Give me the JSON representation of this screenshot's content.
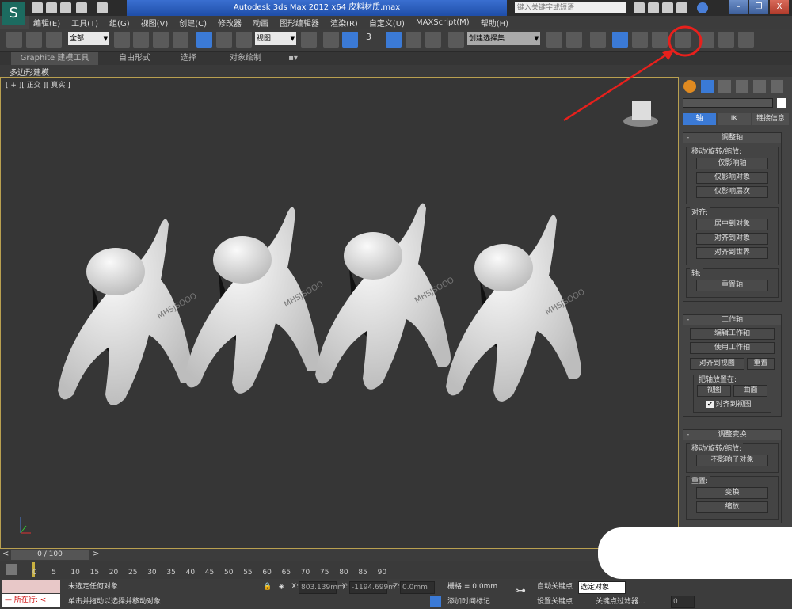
{
  "titlebar": {
    "title": "Autodesk 3ds Max  2012 x64     皮料材质.max",
    "search_placeholder": "键入关键字或短语",
    "min": "–",
    "restore": "❐",
    "close": "X"
  },
  "menu": [
    "编辑(E)",
    "工具(T)",
    "组(G)",
    "视图(V)",
    "创建(C)",
    "修改器",
    "动画",
    "图形编辑器",
    "渲染(R)",
    "自定义(U)",
    "MAXScript(M)",
    "帮助(H)"
  ],
  "toolbar": {
    "selection_filter": "全部",
    "ref_coord": "视图",
    "named_selection": "创建选择集",
    "angle_snap": "3"
  },
  "ribbon": {
    "tabs": [
      "Graphite 建模工具",
      "自由形式",
      "选择",
      "对象绘制"
    ],
    "sub": "多边形建模"
  },
  "viewport": {
    "label": "[ + ][ 正交 ][ 真实 ]",
    "text_on_model": "MHSJSOOO"
  },
  "panel": {
    "tabs": [
      "轴",
      "IK",
      "链接信息"
    ],
    "active_tab": "轴",
    "adjust_pivot": {
      "title": "调整轴",
      "move_group": "移动/旋转/缩放:",
      "buttons": [
        "仅影响轴",
        "仅影响对象",
        "仅影响层次"
      ],
      "align_group": "对齐:",
      "align_buttons": [
        "居中到对象",
        "对齐到对象",
        "对齐到世界"
      ],
      "pivot_group": "轴:",
      "reset_pivot": "重置轴"
    },
    "working_pivot": {
      "title": "工作轴",
      "edit": "编辑工作轴",
      "use": "使用工作轴",
      "align_view": "对齐到视图",
      "reset": "重置",
      "place_group": "把轴放置在:",
      "view": "视图",
      "surface": "曲面",
      "align_checkbox": "对齐到视图",
      "align_checked": true
    },
    "adjust_transform": {
      "title": "调整变换",
      "move_group": "移动/旋转/缩放:",
      "dont_affect": "不影响子对象",
      "reset_group": "重置:",
      "transform": "变换",
      "scale": "缩放"
    }
  },
  "timeline": {
    "frame": "0 / 100",
    "ticks": [
      "0",
      "5",
      "10",
      "15",
      "20",
      "25",
      "30",
      "35",
      "40",
      "45",
      "50",
      "55",
      "60",
      "65",
      "70",
      "75",
      "80",
      "85",
      "90"
    ]
  },
  "status": {
    "script_label": "所在行:",
    "selection": "未选定任何对象",
    "prompt": "单击并拖动以选择并移动对象",
    "x_label": "X:",
    "x": "803.139mm",
    "y_label": "Y:",
    "y": "-1194.699m",
    "z_label": "Z:",
    "z": "0.0mm",
    "grid": "栅格 = 0.0mm",
    "add_time_tag": "添加时间标记",
    "auto_key": "自动关键点",
    "set_key": "设置关键点",
    "key_mode": "选定对象",
    "key_filters": "关键点过滤器...",
    "frame_value": "0"
  },
  "annotation_color": "#e8201c"
}
